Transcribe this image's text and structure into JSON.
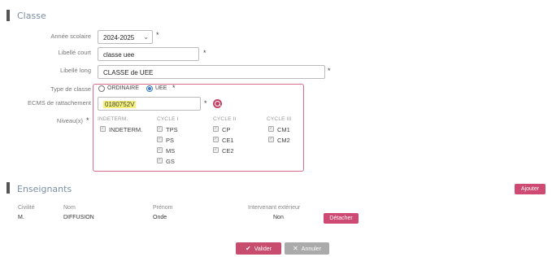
{
  "classe_section": {
    "title": "Classe",
    "fields": {
      "annee_label": "Année scolaire",
      "annee_value": "2024-2025",
      "libelle_court_label": "Libellé court",
      "libelle_court_value": "classe uee",
      "libelle_long_label": "Libellé long",
      "libelle_long_value": "CLASSE de UEE",
      "type_label": "Type de classe",
      "type_options": [
        "ORDINAIRE",
        "UEE"
      ],
      "type_selected": "UEE",
      "ecms_label": "ECMS de rattachement",
      "ecms_value": "0180752V",
      "niveaux_label": "Niveau(x)",
      "required_mark": "*"
    },
    "niveaux": {
      "columns": [
        {
          "title": "INDETERM.",
          "items": [
            "INDETERM."
          ]
        },
        {
          "title": "CYCLE I",
          "items": [
            "TPS",
            "PS",
            "MS",
            "GS"
          ]
        },
        {
          "title": "CYCLE II",
          "items": [
            "CP",
            "CE1",
            "CE2"
          ]
        },
        {
          "title": "CYCLE III",
          "items": [
            "CM1",
            "CM2"
          ]
        }
      ]
    }
  },
  "enseignants_section": {
    "title": "Enseignants",
    "add_button": "Ajouter",
    "headers": [
      "Civilité",
      "Nom",
      "Prénom",
      "Intervenant extérieur"
    ],
    "rows": [
      {
        "civilite": "M.",
        "nom": "DIFFUSION",
        "prenom": "Onde",
        "exterieur": "Non",
        "action": "Détacher"
      }
    ]
  },
  "footer": {
    "validate_label": "Valider",
    "cancel_label": "Annuler"
  },
  "colors": {
    "accent": "#cf4a72",
    "highlight": "#f5f07a",
    "section_title": "#7a8fa3"
  }
}
